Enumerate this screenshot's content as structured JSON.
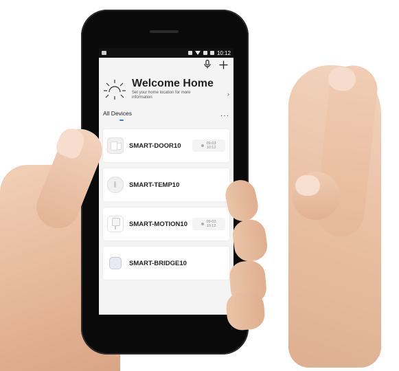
{
  "status_bar": {
    "time": "10:12"
  },
  "header": {
    "mic_icon": "mic-icon",
    "add_icon": "plus-icon"
  },
  "welcome": {
    "title": "Welcome Home",
    "subtitle": "Set your home location for more information",
    "chevron": "›"
  },
  "devices": {
    "section_title": "All Devices",
    "more": "···",
    "items": [
      {
        "name": "SMART-DOOR10",
        "icon": "door-sensor-icon",
        "badge_date": "09-03",
        "badge_time": "10:12"
      },
      {
        "name": "SMART-TEMP10",
        "icon": "temperature-sensor-icon"
      },
      {
        "name": "SMART-MOTION10",
        "icon": "motion-sensor-icon",
        "badge_date": "09-03",
        "badge_time": "10:12"
      },
      {
        "name": "SMART-BRIDGE10",
        "icon": "bridge-hub-icon"
      }
    ]
  },
  "colors": {
    "accent": "#3a7be0",
    "screen_bg": "#f4f4f4",
    "phone_body": "#0a0a0a"
  }
}
